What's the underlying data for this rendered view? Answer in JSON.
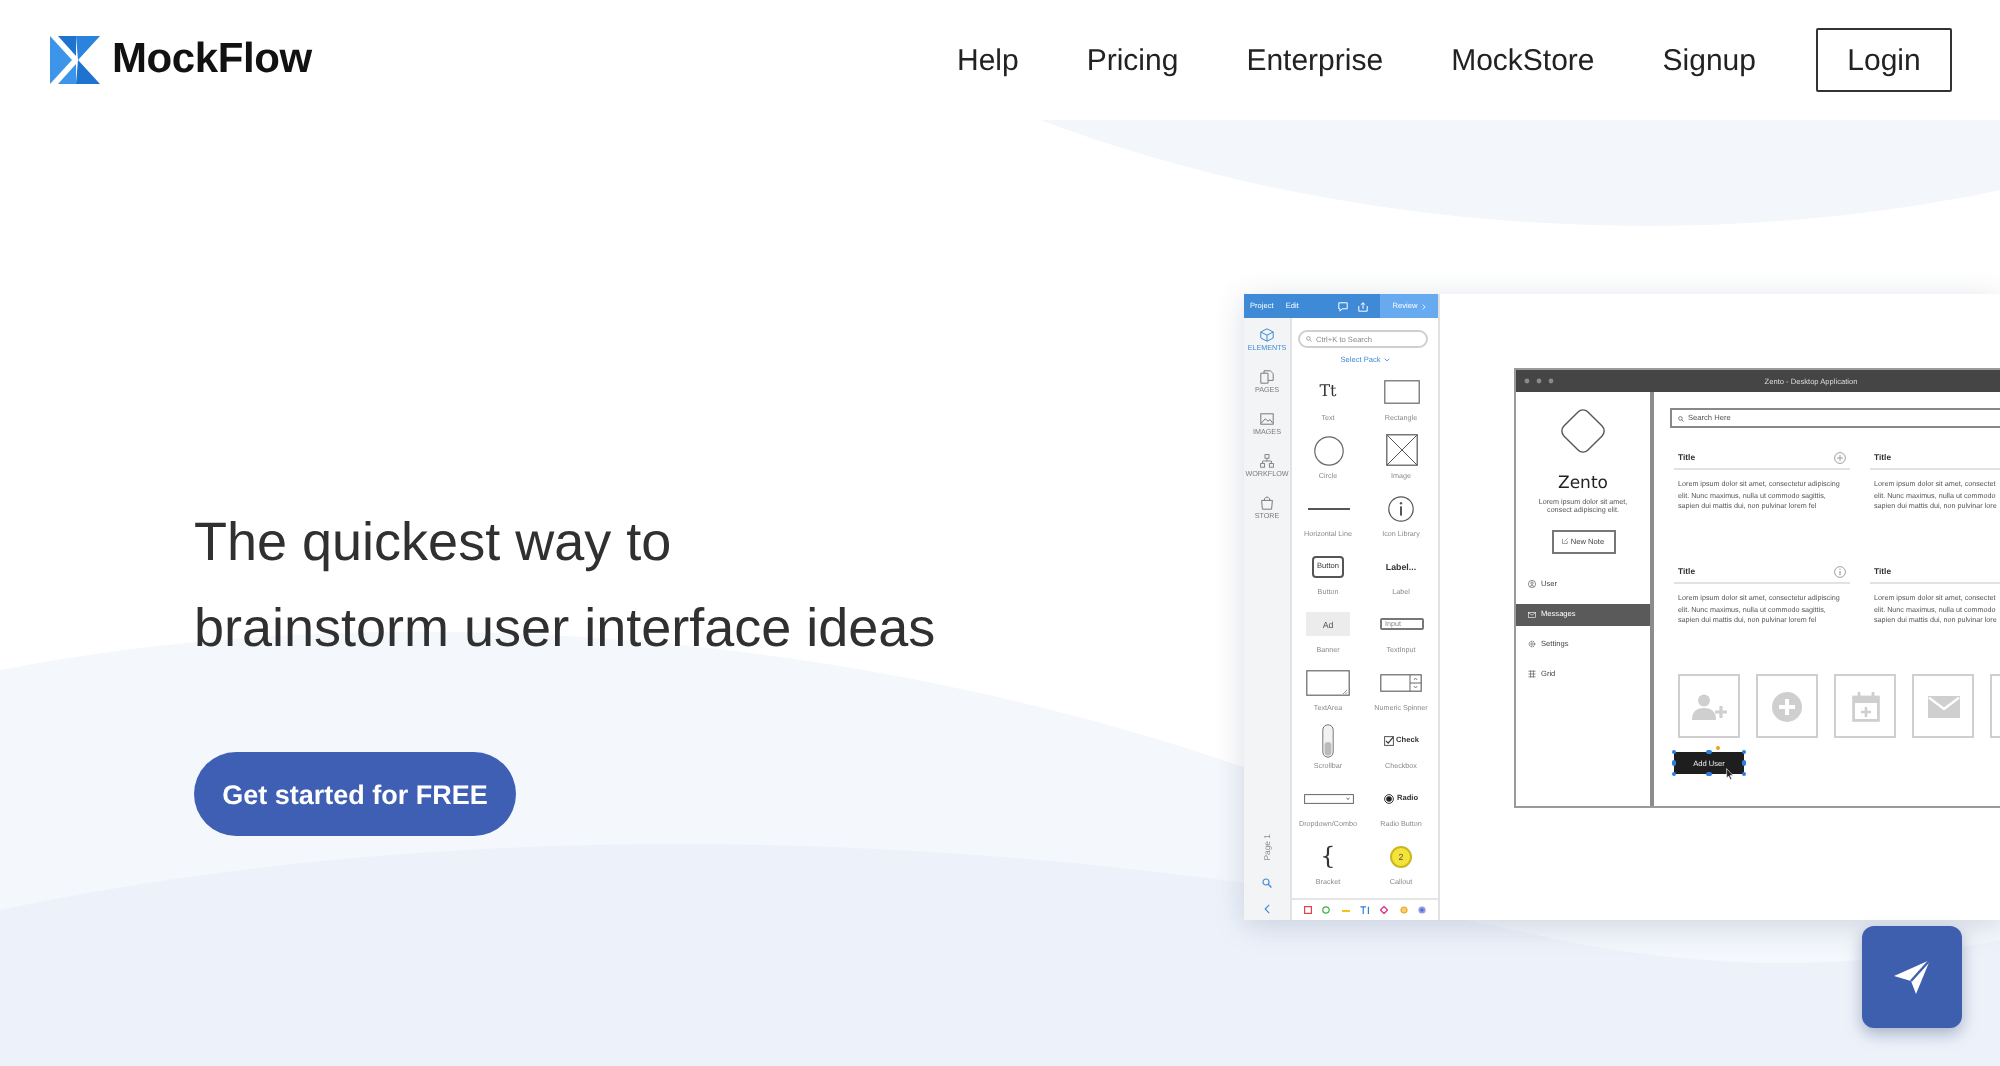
{
  "header": {
    "logo": "MockFlow",
    "nav": [
      "Help",
      "Pricing",
      "Enterprise",
      "MockStore",
      "Signup"
    ],
    "login": "Login"
  },
  "hero": {
    "headline": [
      "The quickest way to",
      "brainstorm user interface ideas"
    ],
    "cta": "Get started for FREE"
  },
  "app_preview": {
    "toolbar": {
      "menu": [
        "Project",
        "Edit"
      ],
      "review": "Review"
    },
    "side_tabs": [
      {
        "kind": "elements",
        "label": "ELEMENTS",
        "selected": true
      },
      {
        "kind": "pages",
        "label": "PAGES",
        "selected": false
      },
      {
        "kind": "images",
        "label": "IMAGES",
        "selected": false
      },
      {
        "kind": "workflow",
        "label": "WORKFLOW",
        "selected": false
      },
      {
        "kind": "store",
        "label": "STORE",
        "selected": false
      }
    ],
    "page_label": "Page 1",
    "search": {
      "placeholder": "Ctrl+K to Search"
    },
    "pack_select": "Select Pack",
    "elements": [
      {
        "kind": "text",
        "label": "Text",
        "sample": "Tt"
      },
      {
        "kind": "circle",
        "label": "Circle"
      },
      {
        "kind": "line",
        "label": "Horizontal Line"
      },
      {
        "kind": "button",
        "label": "Button",
        "sample": "Button"
      },
      {
        "kind": "banner",
        "label": "Banner",
        "sample": "Ad"
      },
      {
        "kind": "textarea",
        "label": "TextArea"
      },
      {
        "kind": "scrollbar",
        "label": "Scrollbar"
      },
      {
        "kind": "dropdown",
        "label": "Dropdown/Combo"
      },
      {
        "kind": "bracket",
        "label": "Bracket",
        "sample": "{"
      },
      {
        "kind": "rectangle",
        "label": "Rectangle"
      },
      {
        "kind": "image",
        "label": "Image"
      },
      {
        "kind": "icon",
        "label": "Icon Library"
      },
      {
        "kind": "label",
        "label": "Label",
        "sample": "Label..."
      },
      {
        "kind": "input",
        "label": "TextInput",
        "sample": "Input"
      },
      {
        "kind": "spinner",
        "label": "Numeric Spinner"
      },
      {
        "kind": "checkbox",
        "label": "Checkbox",
        "sample": "Check",
        "checked": true
      },
      {
        "kind": "radio",
        "label": "Radio Button",
        "sample": "Radio",
        "selected": true
      },
      {
        "kind": "callout",
        "label": "Callout",
        "sample": "2"
      }
    ],
    "mockup": {
      "title": "Zento - Desktop Application",
      "brand": "Zento",
      "tagline": [
        "Lorem ipsum dolor sit amet,",
        "consect adipiscing elit."
      ],
      "new_note": "New Note",
      "nav": [
        {
          "kind": "user",
          "label": "User",
          "selected": false
        },
        {
          "kind": "messages",
          "label": "Messages",
          "selected": true
        },
        {
          "kind": "settings",
          "label": "Settings",
          "selected": false
        },
        {
          "kind": "grid",
          "label": "Grid",
          "selected": false
        }
      ],
      "search": {
        "placeholder": "Search Here"
      },
      "cards": [
        {
          "kind": "add",
          "title": "Title",
          "lines": [
            "Lorem ipsum dolor sit amet, consectetur adipiscing",
            "elit. Nunc maximus, nulla ut commodo sagittis,",
            "sapien dui mattis dui, non pulvinar lorem fel"
          ]
        },
        {
          "kind": "plain",
          "title": "Title",
          "lines": [
            "Lorem ipsum dolor sit amet, consectet",
            "elit. Nunc maximus, nulla ut commodo",
            "sapien dui mattis dui, non pulvinar lore"
          ]
        },
        {
          "kind": "info",
          "title": "Title",
          "lines": [
            "Lorem ipsum dolor sit amet, consectetur adipiscing",
            "elit. Nunc maximus, nulla ut commodo sagittis,",
            "sapien dui mattis dui, non pulvinar lorem fel"
          ]
        },
        {
          "kind": "plain",
          "title": "Title",
          "lines": [
            "Lorem ipsum dolor sit amet, consectet",
            "elit. Nunc maximus, nulla ut commodo",
            "sapien dui mattis dui, non pulvinar lore"
          ]
        }
      ],
      "selected_button": "Add User"
    }
  }
}
